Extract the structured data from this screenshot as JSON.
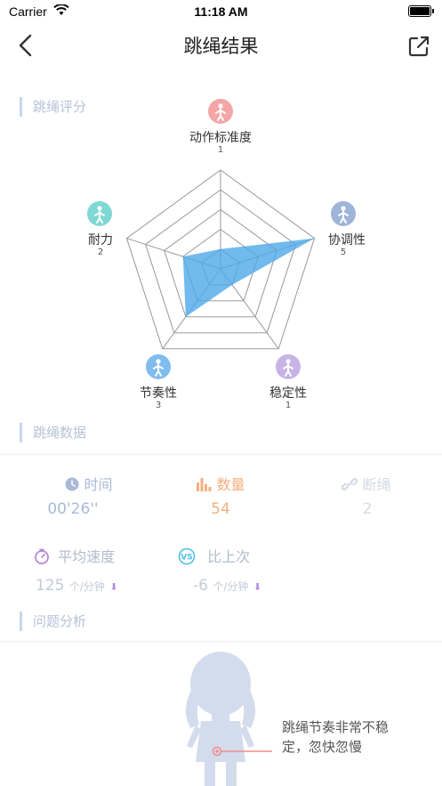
{
  "status_bar": {
    "carrier": "Carrier",
    "time": "11:18 AM"
  },
  "nav": {
    "title": "跳绳结果"
  },
  "sections": {
    "score": "跳绳评分",
    "data": "跳绳数据",
    "analysis": "问题分析"
  },
  "radar": {
    "items": [
      {
        "label": "动作标准度",
        "score": "1",
        "value": 1,
        "color": "#f4a6a6"
      },
      {
        "label": "协调性",
        "score": "5",
        "value": 5,
        "color": "#9fb4d9"
      },
      {
        "label": "稳定性",
        "score": "1",
        "value": 1,
        "color": "#c7b3e5"
      },
      {
        "label": "节奏性",
        "score": "3",
        "value": 3,
        "color": "#7fbcef"
      },
      {
        "label": "耐力",
        "score": "2",
        "value": 2,
        "color": "#7fd8d4"
      }
    ],
    "max": 5,
    "fill_color": "#4fa9ea"
  },
  "stats": {
    "time": {
      "label": "时间",
      "value": "00'26''",
      "color": "#a9bad6"
    },
    "count": {
      "label": "数量",
      "value": "54",
      "color": "#f4b07f"
    },
    "break": {
      "label": "断绳",
      "value": "2",
      "color": "#d5dbe5"
    },
    "avg_speed": {
      "label": "平均速度",
      "value": "125",
      "unit": "个/分钟"
    },
    "compare": {
      "label": "比上次",
      "value": "-6",
      "unit": "个/分钟"
    }
  },
  "analysis": {
    "text_line1": "跳绳节奏非常不稳",
    "text_line2": "定，忽快忽慢"
  }
}
